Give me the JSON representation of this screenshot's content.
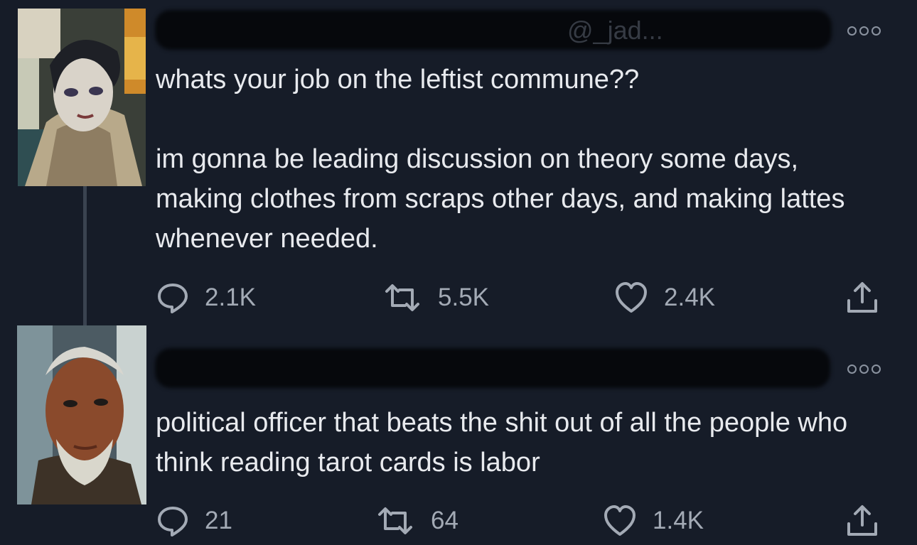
{
  "tweets": [
    {
      "handle": "@_jad...",
      "text": "whats your job on the leftist commune??\n\nim gonna be leading discussion on theory some days, making clothes from scraps other days, and making lattes whenever needed.",
      "replies": "2.1K",
      "retweets": "5.5K",
      "likes": "2.4K"
    },
    {
      "text": "political officer that beats the shit out of all the people who think reading tarot cards is labor",
      "replies": "21",
      "retweets": "64",
      "likes": "1.4K"
    }
  ],
  "colors": {
    "background": "#161c28",
    "text": "#e8eaee",
    "muted": "#a3aab5",
    "redaction": "#06080c"
  },
  "icons": [
    "more-icon",
    "reply-icon",
    "retweet-icon",
    "like-icon",
    "share-icon"
  ]
}
